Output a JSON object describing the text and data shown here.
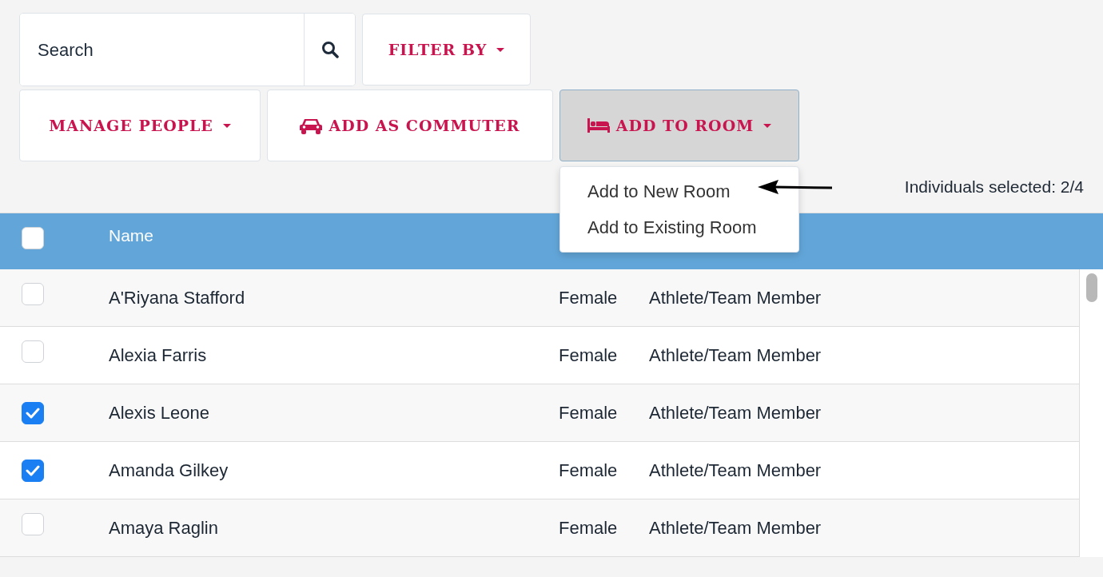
{
  "search": {
    "placeholder": "Search"
  },
  "filter_button": {
    "label": "FILTER BY",
    "caret": true,
    "active": false
  },
  "actions": [
    {
      "label": "MANAGE PEOPLE",
      "kind": "plain",
      "caret": true,
      "active": false
    },
    {
      "label": "ADD AS COMMUTER",
      "kind": "car",
      "caret": false,
      "active": false
    },
    {
      "label": "ADD TO ROOM",
      "kind": "bed",
      "caret": true,
      "active": true,
      "menu": [
        "Add to New Room",
        "Add to Existing Room"
      ]
    }
  ],
  "selection_count": "Individuals selected: 2/4",
  "table": {
    "header_checked": false,
    "columns": [
      "Name"
    ],
    "rows": [
      {
        "name": "A'Riyana Stafford",
        "gender": "Female",
        "role": "Athlete/Team Member",
        "checked": false
      },
      {
        "name": "Alexia Farris",
        "gender": "Female",
        "role": "Athlete/Team Member",
        "checked": false
      },
      {
        "name": "Alexis Leone",
        "gender": "Female",
        "role": "Athlete/Team Member",
        "checked": true
      },
      {
        "name": "Amanda Gilkey",
        "gender": "Female",
        "role": "Athlete/Team Member",
        "checked": true
      },
      {
        "name": "Amaya Raglin",
        "gender": "Female",
        "role": "Athlete/Team Member",
        "checked": false
      }
    ]
  }
}
